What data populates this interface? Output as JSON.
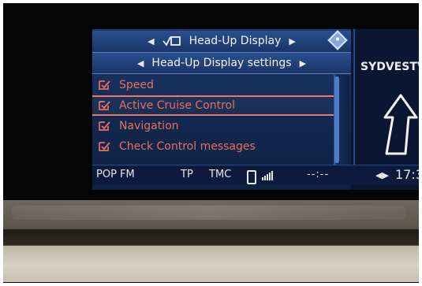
{
  "menu": {
    "title": "Head-Up Display",
    "subtitle": "Head-Up Display settings",
    "items": [
      {
        "label": "Speed",
        "checked": true
      },
      {
        "label": "Active Cruise Control",
        "checked": true,
        "selected": true
      },
      {
        "label": "Navigation",
        "checked": true
      },
      {
        "label": "Check Control messages",
        "checked": true
      }
    ]
  },
  "status": {
    "radio": "POP FM",
    "tp": "TP",
    "tmc": "TMC",
    "time_placeholder": "--:--",
    "clock": "17:3"
  },
  "navigation": {
    "street": "SYDVESTV"
  },
  "colors": {
    "menu_text": "#e96f5d",
    "header_text": "#f2f2f2",
    "screen_bg": "#13284f"
  }
}
